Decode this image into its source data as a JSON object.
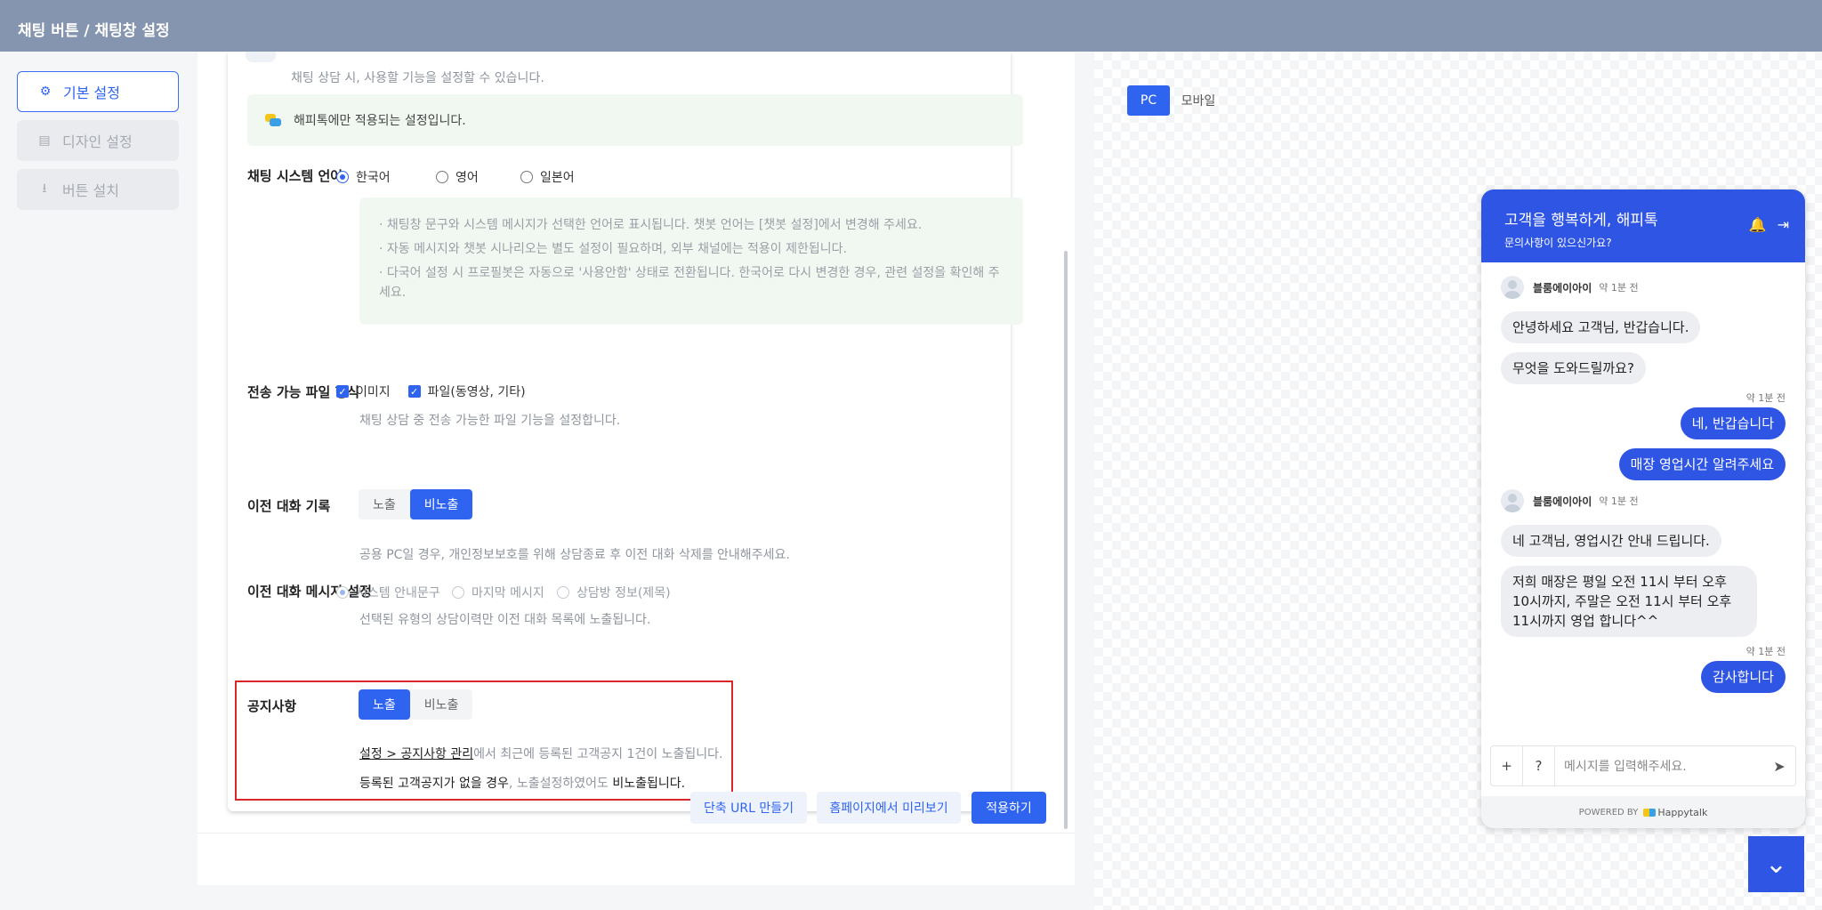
{
  "header": {
    "title": "채팅 버튼 / 채팅창 설정"
  },
  "sidebar": {
    "items": [
      {
        "label": "기본 설정",
        "icon": "gear-icon",
        "active": true
      },
      {
        "label": "디자인 설정",
        "icon": "document-icon",
        "active": false
      },
      {
        "label": "버튼 설치",
        "icon": "download-icon",
        "active": false
      }
    ]
  },
  "settings": {
    "top_desc": "채팅 상담 시, 사용할 기능을 설정할 수 있습니다.",
    "hint": "해피톡에만 적용되는 설정입니다.",
    "language": {
      "label": "채팅 시스템 언어",
      "options": [
        "한국어",
        "영어",
        "일본어"
      ],
      "selected": "한국어",
      "notes": [
        "· 채팅창 문구와 시스템 메시지가 선택한 언어로 표시됩니다. 챗봇 언어는 [챗봇 설정]에서 변경해 주세요.",
        "· 자동 메시지와 챗봇 시나리오는 별도 설정이 필요하며, 외부 채널에는 적용이 제한됩니다.",
        "· 다국어 설정 시 프로필봇은 자동으로 '사용안함' 상태로 전환됩니다. 한국어로 다시 변경한 경우, 관련 설정을 확인해 주세요."
      ]
    },
    "file_types": {
      "label": "전송 가능 파일 형식",
      "options": [
        "이미지",
        "파일(동영상, 기타)"
      ],
      "desc": "채팅 상담 중 전송 가능한 파일 기능을 설정합니다."
    },
    "history": {
      "label": "이전 대화 기록",
      "options": [
        "노출",
        "비노출"
      ],
      "selected": "비노출",
      "desc": "공용 PC일 경우, 개인정보보호를 위해 상담종료 후 이전 대화 삭제를 안내해주세요."
    },
    "history_msg": {
      "label": "이전 대화 메시지 설정",
      "options": [
        "시스템 안내문구",
        "마지막 메시지",
        "상담방 정보(제목)"
      ],
      "selected": "시스템 안내문구",
      "desc": "선택된 유형의 상담이력만 이전 대화 목록에 노출됩니다."
    },
    "notice": {
      "label": "공지사항",
      "options": [
        "노출",
        "비노출"
      ],
      "selected": "노출",
      "link": "설정 > 공지사항 관리",
      "desc1_rest": "에서 최근에 등록된 고객공지 1건이 노출됩니다.",
      "desc2_a": "등록된 고객공지가 없을 경우",
      "desc2_b": ", 노출설정하였어도 ",
      "desc2_c": "비노출됩니다."
    }
  },
  "footer": {
    "short_url": "단축 URL 만들기",
    "preview": "홈페이지에서 미리보기",
    "apply": "적용하기"
  },
  "preview": {
    "tabs": [
      "PC",
      "모바일"
    ],
    "selected_tab": "PC",
    "chat": {
      "title": "고객을 행복하게, 해피톡",
      "subtitle": "문의사항이 있으신가요?",
      "agent": "블룸에이아이",
      "time": "약 1분 전",
      "messages": [
        "안녕하세요 고객님, 반갑습니다.",
        "무엇을 도와드릴까요?",
        "네, 반갑습니다",
        "매장 영업시간 알려주세요",
        "네 고객님, 영업시간 안내 드립니다.",
        "저희 매장은 평일 오전 11시 부터 오후 10시까지, 주말은 오전 11시 부터 오후 11시까지 영업 합니다^^",
        "감사합니다"
      ],
      "input_placeholder": "메시지를 입력해주세요.",
      "input_buttons": [
        "+",
        "?"
      ],
      "powered_by": "POWERED BY",
      "brand": "Happytalk"
    }
  },
  "colors": {
    "accent": "#2f64f0",
    "chat_header": "#2f55e4",
    "highlight_box": "#d9262b"
  }
}
